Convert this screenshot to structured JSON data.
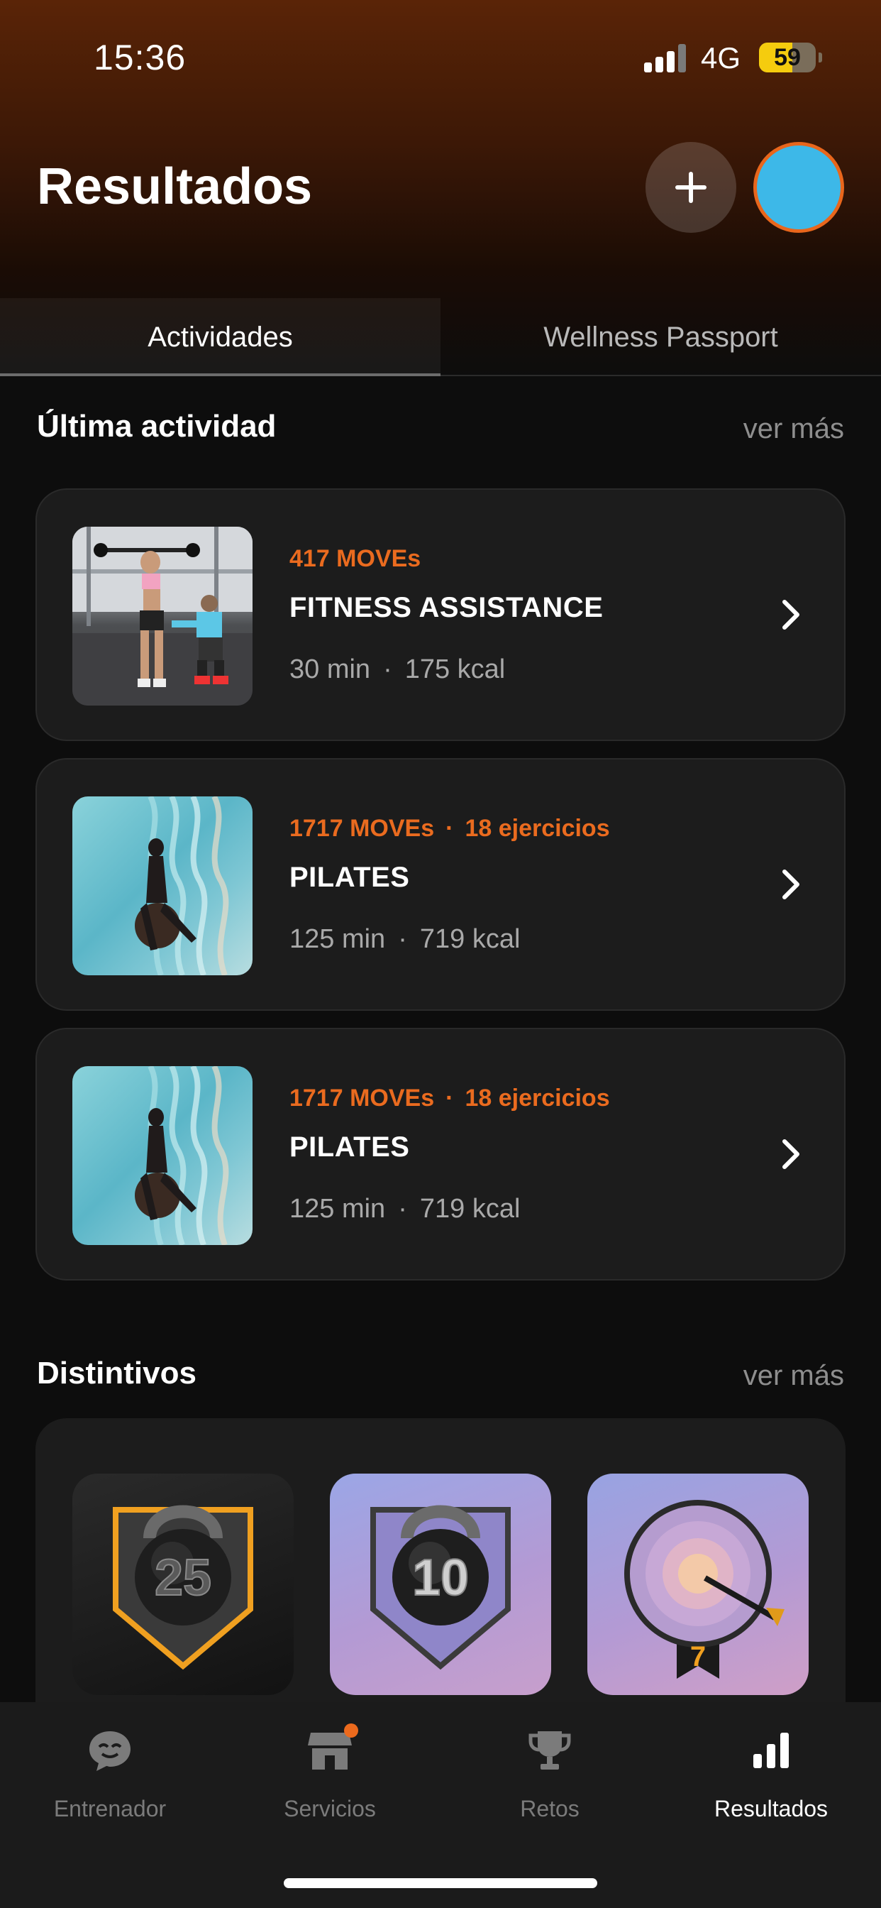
{
  "status_bar": {
    "time": "15:36",
    "network": "4G",
    "battery_level": "59",
    "signal_bars_active": 3,
    "signal_bars_total": 4
  },
  "header": {
    "title": "Resultados",
    "add_icon": "plus-icon",
    "avatar_color": "#3db8e8",
    "avatar_border": "#e8661c"
  },
  "tabs": [
    {
      "label": "Actividades",
      "active": true
    },
    {
      "label": "Wellness Passport",
      "active": false
    }
  ],
  "last_activity": {
    "title": "Última actividad",
    "see_more": "ver más",
    "items": [
      {
        "moves": "417 MOVEs",
        "exercises": "",
        "name": "FITNESS ASSISTANCE",
        "duration": "30 min",
        "kcal": "175 kcal",
        "thumb": "gym-training-photo"
      },
      {
        "moves": "1717 MOVEs",
        "exercises": "18 ejercicios",
        "name": "PILATES",
        "duration": "125 min",
        "kcal": "719 kcal",
        "thumb": "pilates-photo"
      },
      {
        "moves": "1717 MOVEs",
        "exercises": "18 ejercicios",
        "name": "PILATES",
        "duration": "125 min",
        "kcal": "719 kcal",
        "thumb": "pilates-photo"
      }
    ]
  },
  "badges": {
    "title": "Distintivos",
    "see_more": "ver más",
    "items": [
      {
        "icon": "kettlebell-badge-icon",
        "number": "25"
      },
      {
        "icon": "kettlebell-badge-icon",
        "number": "10"
      },
      {
        "icon": "target-badge-icon",
        "number": "7"
      }
    ]
  },
  "bottom_nav": [
    {
      "label": "Entrenador",
      "icon": "chat-bubble-icon",
      "active": false
    },
    {
      "label": "Servicios",
      "icon": "store-icon",
      "active": false,
      "notification": true
    },
    {
      "label": "Retos",
      "icon": "trophy-icon",
      "active": false
    },
    {
      "label": "Resultados",
      "icon": "bar-chart-icon",
      "active": true
    }
  ],
  "colors": {
    "accent": "#ea6b1f",
    "background": "#0d0d0d",
    "card": "#1c1c1c",
    "muted_text": "#a9a9a9"
  }
}
